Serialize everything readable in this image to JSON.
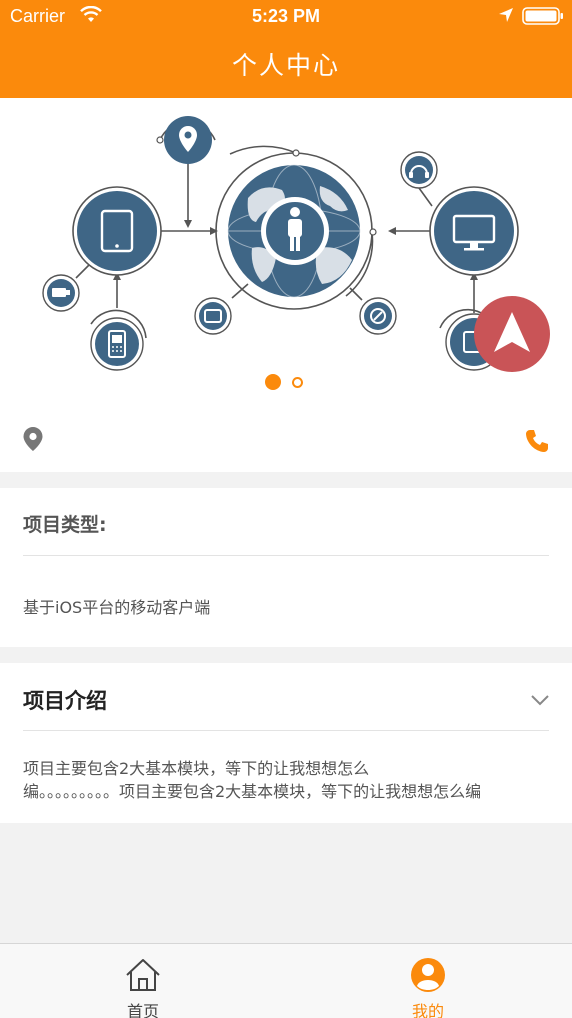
{
  "status_bar": {
    "carrier": "Carrier",
    "time": "5:23 PM",
    "icons": [
      "wifi-icon",
      "location-arrow-icon",
      "battery-icon"
    ]
  },
  "nav": {
    "title": "个人中心"
  },
  "banner": {
    "image": "network-globe-illustration",
    "page_count": 2,
    "current_page": 1
  },
  "contact": {
    "icons": [
      "location-pin-icon",
      "phone-icon"
    ]
  },
  "project_type": {
    "heading": "项目类型:",
    "value": "基于iOS平台的移动客户端"
  },
  "project_intro": {
    "heading": "项目介绍",
    "line1": "项目主要包含2大基本模块，等下的让我想想怎么",
    "line2": "编。。。。。。。。。项目主要包含2大基本模块，等下的让我想想怎么编"
  },
  "tabs": [
    {
      "label": "首页",
      "icon": "home-icon",
      "active": false
    },
    {
      "label": "我的",
      "icon": "user-icon",
      "active": true
    }
  ],
  "colors": {
    "accent": "#fb8a0c",
    "fab": "#c95457",
    "illustration": "#3f6686"
  }
}
